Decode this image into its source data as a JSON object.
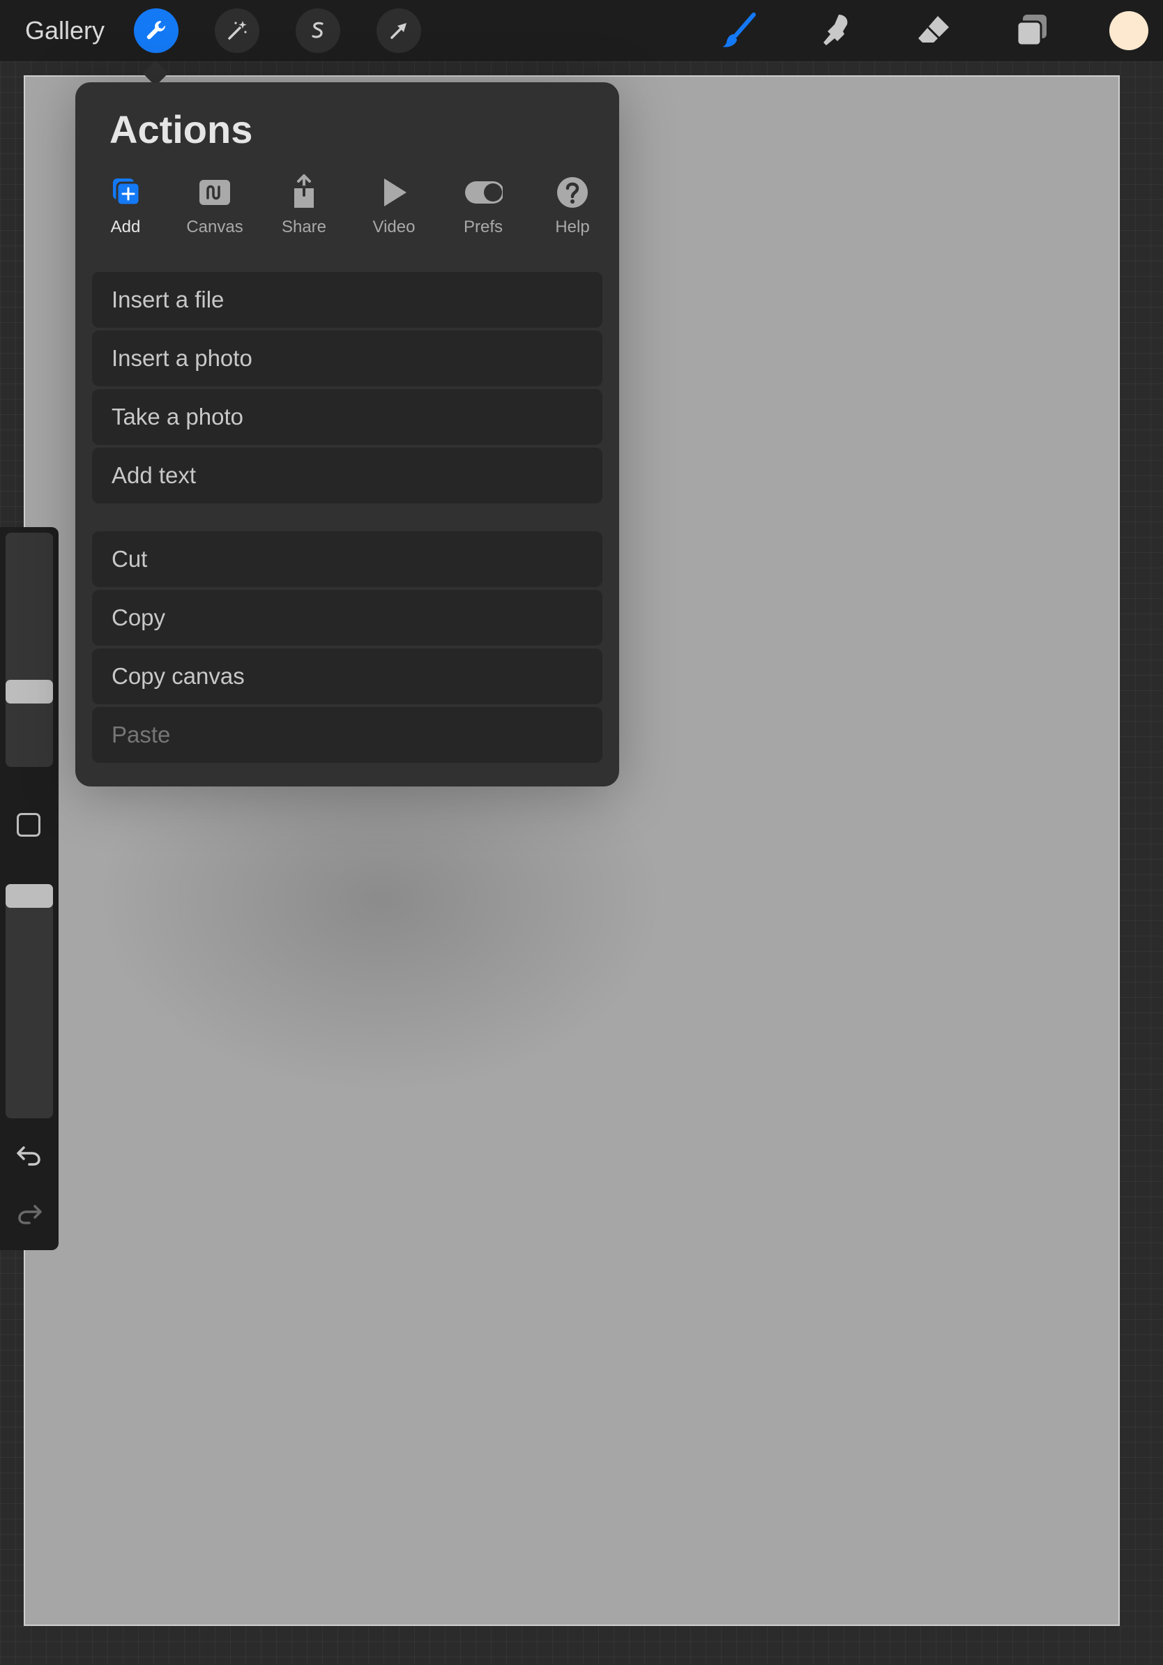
{
  "toolbar": {
    "gallery_label": "Gallery",
    "left_tools": [
      {
        "icon": "wrench-icon",
        "active": true
      },
      {
        "icon": "magic-wand-icon",
        "active": false
      },
      {
        "icon": "selection-s-icon",
        "active": false
      },
      {
        "icon": "transform-arrow-icon",
        "active": false
      }
    ],
    "right_tools": [
      {
        "icon": "brush-icon",
        "active": true
      },
      {
        "icon": "smudge-icon",
        "active": false
      },
      {
        "icon": "eraser-icon",
        "active": false
      },
      {
        "icon": "layers-icon",
        "active": false
      }
    ],
    "current_color": "#fde9cf",
    "accent_color": "#1479f5"
  },
  "actions": {
    "title": "Actions",
    "tabs": [
      {
        "label": "Add",
        "icon": "add-layer-icon",
        "active": true
      },
      {
        "label": "Canvas",
        "icon": "canvas-icon",
        "active": false
      },
      {
        "label": "Share",
        "icon": "share-icon",
        "active": false
      },
      {
        "label": "Video",
        "icon": "play-icon",
        "active": false
      },
      {
        "label": "Prefs",
        "icon": "toggle-icon",
        "active": false
      },
      {
        "label": "Help",
        "icon": "help-icon",
        "active": false
      }
    ],
    "group1": [
      "Insert a file",
      "Insert a photo",
      "Take a photo",
      "Add text"
    ],
    "group2": [
      "Cut",
      "Copy",
      "Copy canvas",
      "Paste"
    ],
    "disabled_items": [
      "Paste"
    ]
  },
  "sidebar": {
    "brush_size_level": 0.3,
    "opacity_level": 1.0,
    "redo_enabled": false
  }
}
